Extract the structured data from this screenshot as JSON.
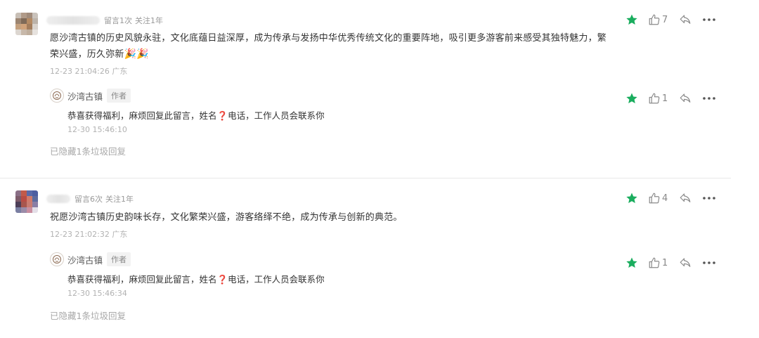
{
  "colors": {
    "star": "#1aad5e",
    "icon": "#8a8a8a",
    "question_mark": "#d21f1f"
  },
  "comments": [
    {
      "avatar_icon": "user-avatar-blurred",
      "messages_label": "留言1次",
      "follow_label": "关注1年",
      "content": "愿沙湾古镇的历史风貌永驻，文化底蕴日益深厚，成为传承与发扬中华优秀传统文化的重要阵地，吸引更多游客前来感受其独特魅力，繁荣兴盛，历久弥新",
      "emoji": "🎉🎉",
      "time": "12-23 21:04:26 广东",
      "likes": "7",
      "reply": {
        "name": "沙湾古镇",
        "author_tag": "作者",
        "content_before": "恭喜获得福利，麻烦回复此留言，姓名",
        "content_mark": "❓",
        "content_after": "电话，工作人员会联系你",
        "time": "12-30 15:46:10",
        "likes": "1"
      },
      "hidden_note": "已隐藏1条垃圾回复"
    },
    {
      "avatar_icon": "user-avatar-blurred",
      "messages_label": "留言6次",
      "follow_label": "关注1年",
      "content": "祝愿沙湾古镇历史韵味长存，文化繁荣兴盛，游客络绎不绝，成为传承与创新的典范。",
      "emoji": "",
      "time": "12-23 21:02:32 广东",
      "likes": "4",
      "reply": {
        "name": "沙湾古镇",
        "author_tag": "作者",
        "content_before": "恭喜获得福利，麻烦回复此留言，姓名",
        "content_mark": "❓",
        "content_after": "电话，工作人员会联系你",
        "time": "12-30 15:46:34",
        "likes": "1"
      },
      "hidden_note": "已隐藏1条垃圾回复"
    }
  ]
}
